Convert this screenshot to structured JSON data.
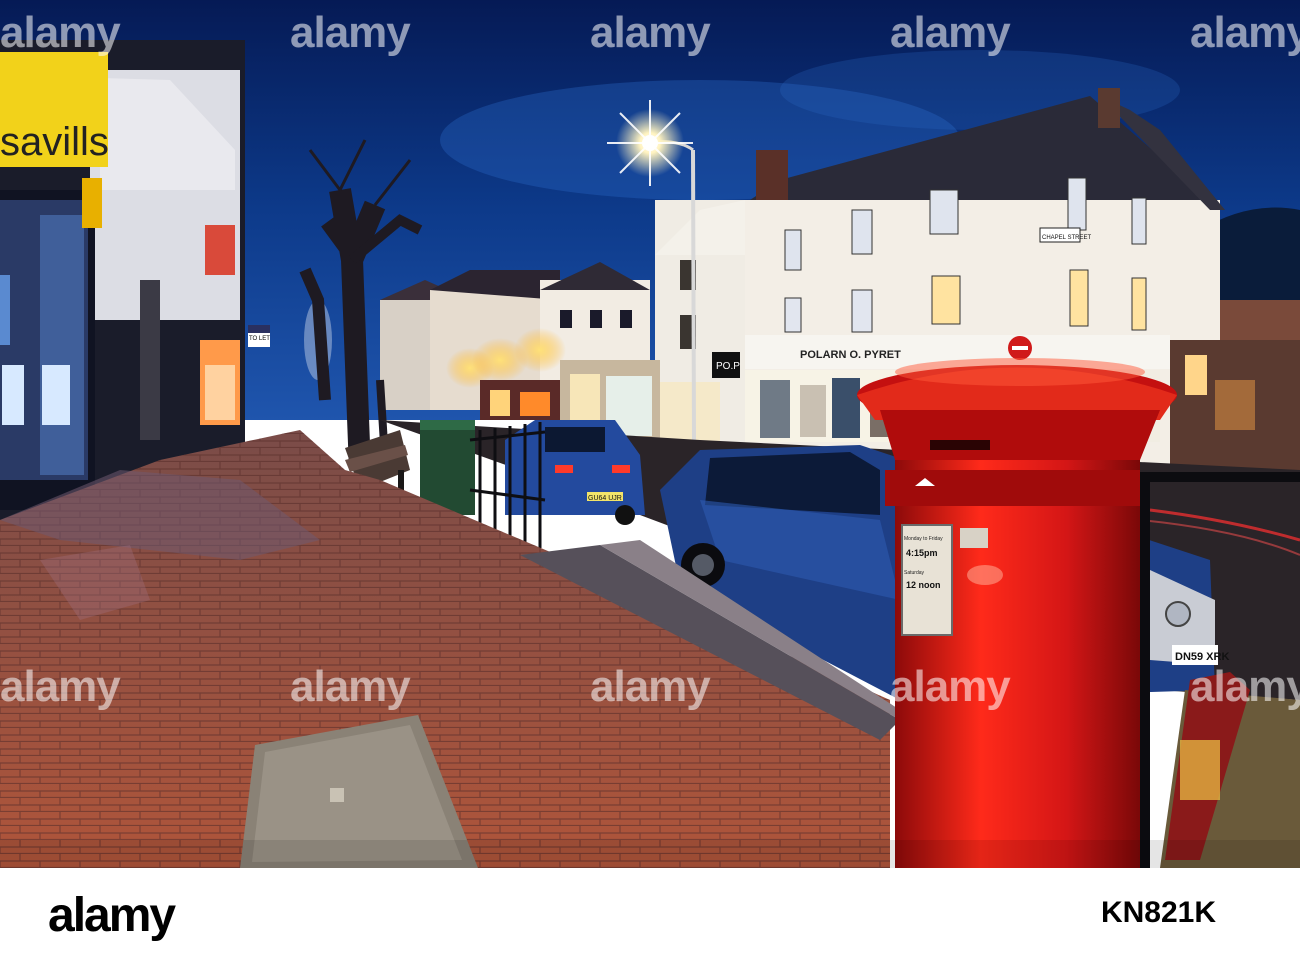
{
  "photo": {
    "signs": {
      "agency": "savills",
      "shop_main": "POLARN O. PYRET",
      "shop_small": "PO.P",
      "to_let": "TO LET",
      "street_name": "CHAPEL STREET"
    },
    "plates": {
      "blue_car": "GU64 UJR",
      "dark_car": "DN59 XRK"
    },
    "postbox_notice": {
      "weekday": "Monday to Friday",
      "weekday_time": "4:15pm",
      "saturday": "Saturday",
      "saturday_time": "12 noon"
    },
    "colors": {
      "sky": "#0d3a8a",
      "postbox_red": "#d41616",
      "pavement": "#8a4a3a",
      "savills_yellow": "#f2d21a",
      "car_blue": "#1e3f86"
    }
  },
  "watermark": {
    "text": "alamy"
  },
  "footer": {
    "logo": "alamy",
    "image_id": "KN821K"
  }
}
